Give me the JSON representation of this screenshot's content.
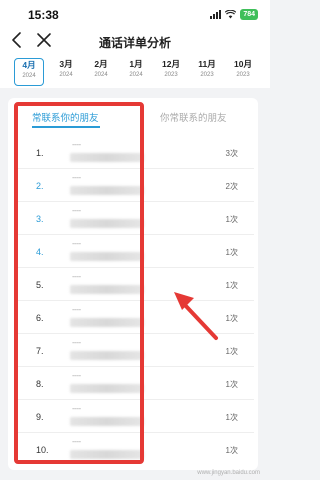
{
  "status_bar": {
    "time": "15:38",
    "battery": "784"
  },
  "nav": {
    "title": "通话详单分析"
  },
  "months": [
    {
      "month": "4月",
      "year": "2024",
      "active": true
    },
    {
      "month": "3月",
      "year": "2024"
    },
    {
      "month": "2月",
      "year": "2024"
    },
    {
      "month": "1月",
      "year": "2024"
    },
    {
      "month": "12月",
      "year": "2023"
    },
    {
      "month": "11月",
      "year": "2023"
    },
    {
      "month": "10月",
      "year": "2023"
    }
  ],
  "tabs": [
    {
      "label": "常联系你的朋友",
      "active": true
    },
    {
      "label": "你常联系的朋友",
      "active": false
    }
  ],
  "contacts": [
    {
      "rank": "1.",
      "name": "----",
      "count": "3次"
    },
    {
      "rank": "2.",
      "name": "----",
      "count": "2次"
    },
    {
      "rank": "3.",
      "name": "----",
      "count": "1次"
    },
    {
      "rank": "4.",
      "name": "----",
      "count": "1次"
    },
    {
      "rank": "5.",
      "name": "----",
      "count": "1次"
    },
    {
      "rank": "6.",
      "name": "----",
      "count": "1次"
    },
    {
      "rank": "7.",
      "name": "----",
      "count": "1次"
    },
    {
      "rank": "8.",
      "name": "----",
      "count": "1次"
    },
    {
      "rank": "9.",
      "name": "----",
      "count": "1次"
    },
    {
      "rank": "10.",
      "name": "----",
      "count": "1次"
    }
  ],
  "watermark": "www.jingyan.baidu.com",
  "colors": {
    "accent": "#2b9bd6",
    "highlight": "#e53935",
    "battery": "#3fbf5a"
  },
  "icons": [
    "back-arrow-icon",
    "close-icon",
    "signal-icon",
    "wifi-icon",
    "battery-icon"
  ]
}
